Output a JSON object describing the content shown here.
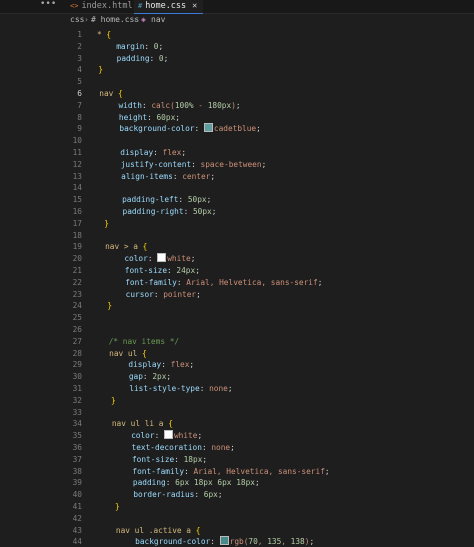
{
  "tabs": [
    {
      "label": "index.html",
      "icon": "html-file-icon",
      "active": false
    },
    {
      "label": "home.css",
      "icon": "css-file-icon",
      "active": true
    }
  ],
  "breadcrumb": [
    "css",
    "# home.css",
    "nav"
  ],
  "colors": {
    "cadetblue": "#5f9ea0",
    "white": "#ffffff",
    "rgb": "#468a8a"
  },
  "lines": [
    {
      "n": "1",
      "t": "* {"
    },
    {
      "n": "2",
      "t": "    margin: 0;"
    },
    {
      "n": "3",
      "t": "    padding: 0;"
    },
    {
      "n": "4",
      "t": "}"
    },
    {
      "n": "5",
      "t": ""
    },
    {
      "n": "6",
      "t": "nav {"
    },
    {
      "n": "7",
      "t": "    width: calc(100% - 180px);"
    },
    {
      "n": "8",
      "t": "    height: 60px;"
    },
    {
      "n": "9",
      "t": "    background-color: cadetblue;"
    },
    {
      "n": "10",
      "t": ""
    },
    {
      "n": "11",
      "t": "    display: flex;"
    },
    {
      "n": "12",
      "t": "    justify-content: space-between;"
    },
    {
      "n": "13",
      "t": "    align-items: center;"
    },
    {
      "n": "14",
      "t": ""
    },
    {
      "n": "15",
      "t": "    padding-left: 50px;"
    },
    {
      "n": "16",
      "t": "    padding-right: 50px;"
    },
    {
      "n": "17",
      "t": "}"
    },
    {
      "n": "18",
      "t": ""
    },
    {
      "n": "19",
      "t": "nav > a {"
    },
    {
      "n": "20",
      "t": "    color: white;"
    },
    {
      "n": "21",
      "t": "    font-size: 24px;"
    },
    {
      "n": "22",
      "t": "    font-family: Arial, Helvetica, sans-serif;"
    },
    {
      "n": "23",
      "t": "    cursor: pointer;"
    },
    {
      "n": "24",
      "t": "}"
    },
    {
      "n": "25",
      "t": ""
    },
    {
      "n": "26",
      "t": ""
    },
    {
      "n": "27",
      "t": "/* nav items */"
    },
    {
      "n": "28",
      "t": "nav ul {"
    },
    {
      "n": "29",
      "t": "    display: flex;"
    },
    {
      "n": "30",
      "t": "    gap: 2px;"
    },
    {
      "n": "31",
      "t": "    list-style-type: none;"
    },
    {
      "n": "32",
      "t": "}"
    },
    {
      "n": "33",
      "t": ""
    },
    {
      "n": "34",
      "t": "nav ul li a {"
    },
    {
      "n": "35",
      "t": "    color: white;"
    },
    {
      "n": "36",
      "t": "    text-decoration: none;"
    },
    {
      "n": "37",
      "t": "    font-size: 18px;"
    },
    {
      "n": "38",
      "t": "    font-family: Arial, Helvetica, sans-serif;"
    },
    {
      "n": "39",
      "t": "    padding: 6px 18px 6px 18px;"
    },
    {
      "n": "40",
      "t": "    border-radius: 6px;"
    },
    {
      "n": "41",
      "t": "}"
    },
    {
      "n": "42",
      "t": ""
    },
    {
      "n": "43",
      "t": "nav ul .active a {"
    },
    {
      "n": "44",
      "t": "    background-color: rgb(70, 135, 138);"
    }
  ]
}
